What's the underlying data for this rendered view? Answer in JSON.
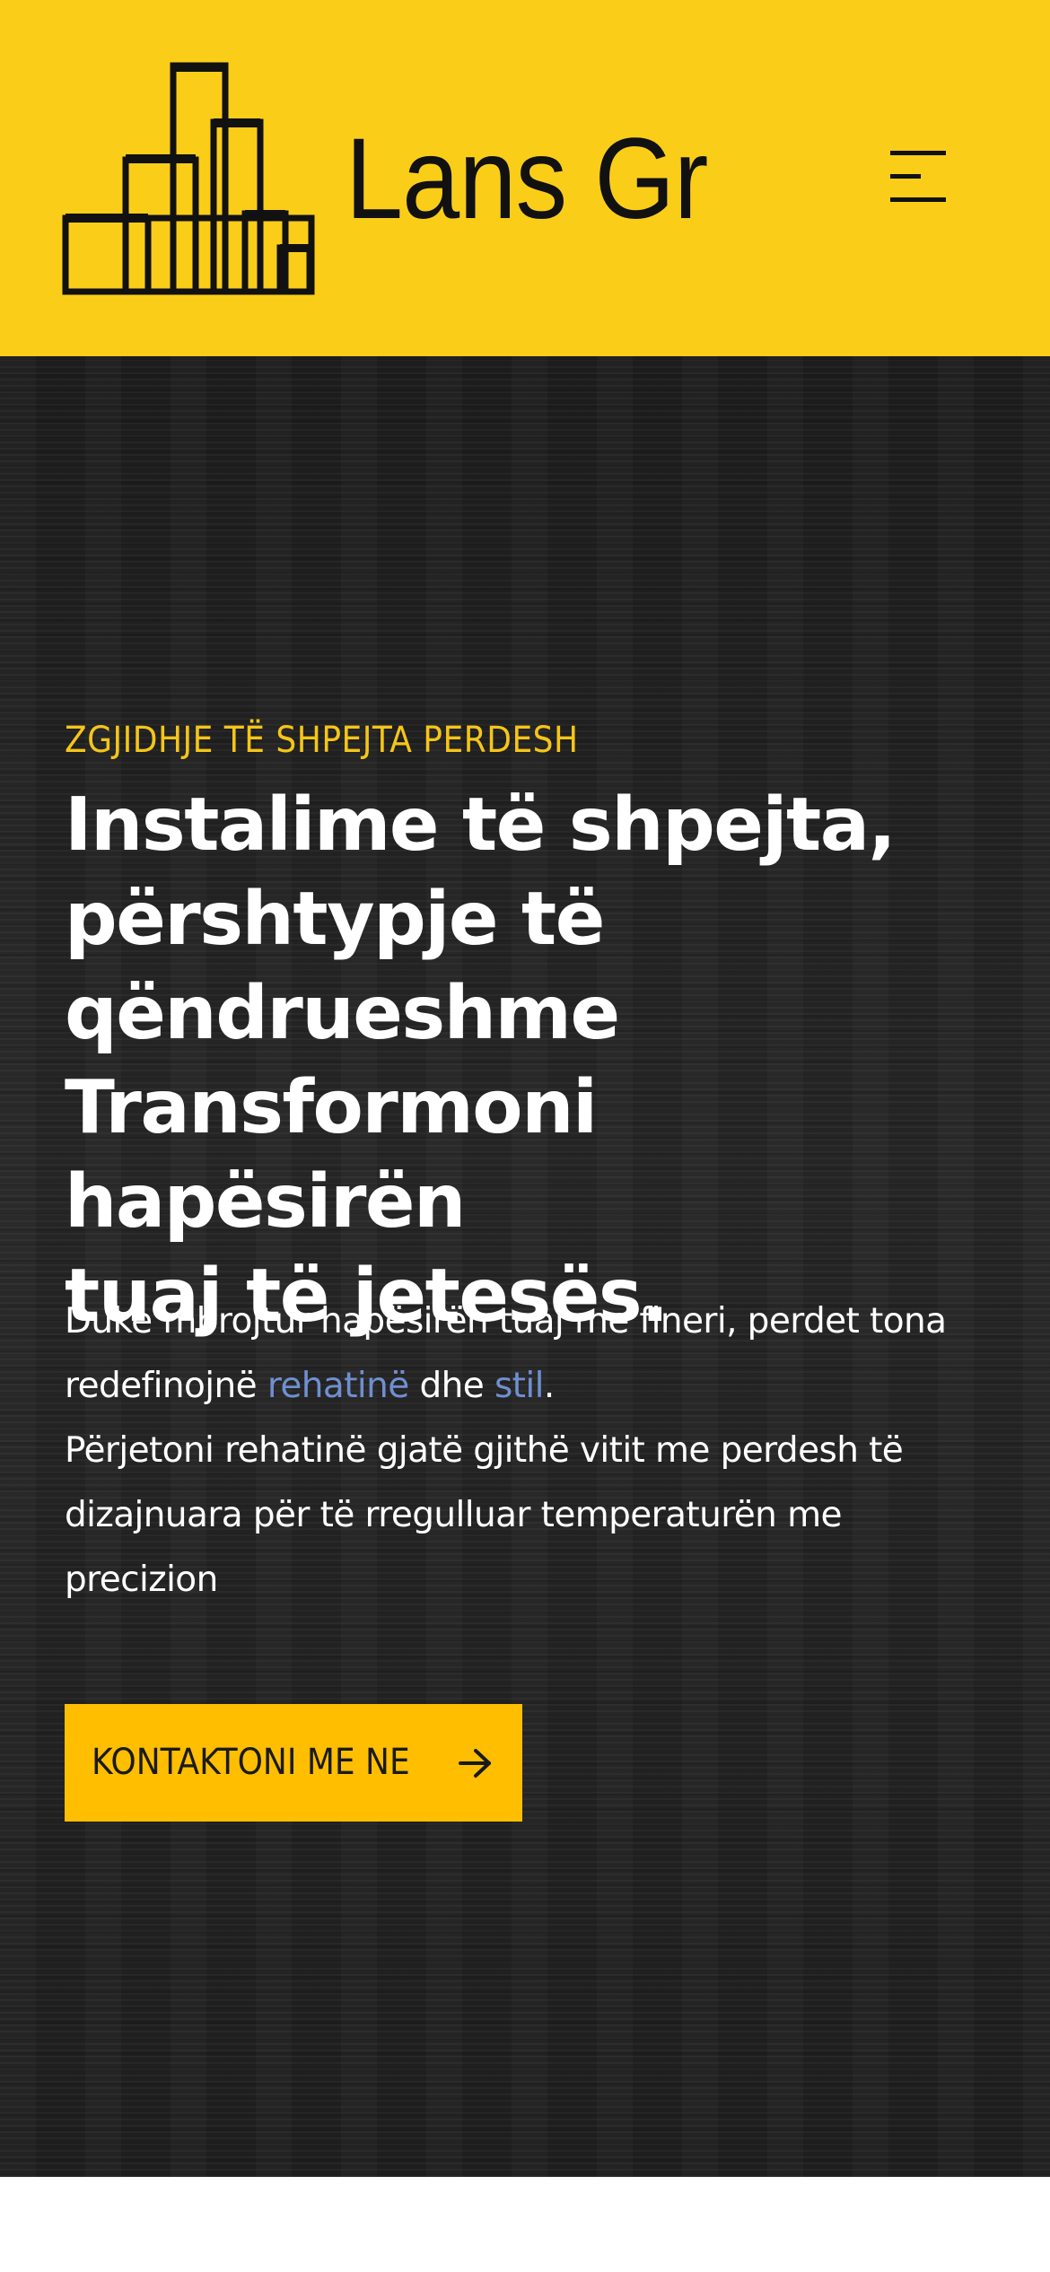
{
  "colors": {
    "header_background": "#FACD19",
    "hero_background": "#222222",
    "accent_yellow": "#F5C518",
    "button_background": "#FFBE00",
    "link_blue": "#6F8FD0",
    "text_dark": "#111111",
    "text_light": "#FFFFFF",
    "page_background": "#FFFFFF"
  },
  "header": {
    "logo_icon": "buildings-icon",
    "site_name": "Lans Gr",
    "menu_icon": "hamburger-menu-icon"
  },
  "hero": {
    "eyebrow": "ZGJIDHJE TË SHPEJTA PERDESH",
    "headline_lines": [
      "Instalime të shpejta,",
      "përshtypje të",
      "qëndrueshme",
      "Transformoni hapësirën",
      "tuaj të jetesës."
    ],
    "paragraph_1": {
      "line_1": "Duke mbrojtur hapësirën tuaj me fineri, perdet tona",
      "line_2_start": "redefinojnë",
      "link_rehatine": "rehatinë",
      "word_dhe": "dhe",
      "link_stil": "stil",
      "end_punctuation": "."
    },
    "paragraph_2_lines": [
      "Përjetoni rehatinë gjatë gjithë vitit me perdesh të",
      "dizajnuara për të rregulluar temperaturën me",
      "precizion"
    ],
    "cta": {
      "label": "KONTAKTONI ME NE",
      "icon": "arrow-right-icon"
    }
  }
}
